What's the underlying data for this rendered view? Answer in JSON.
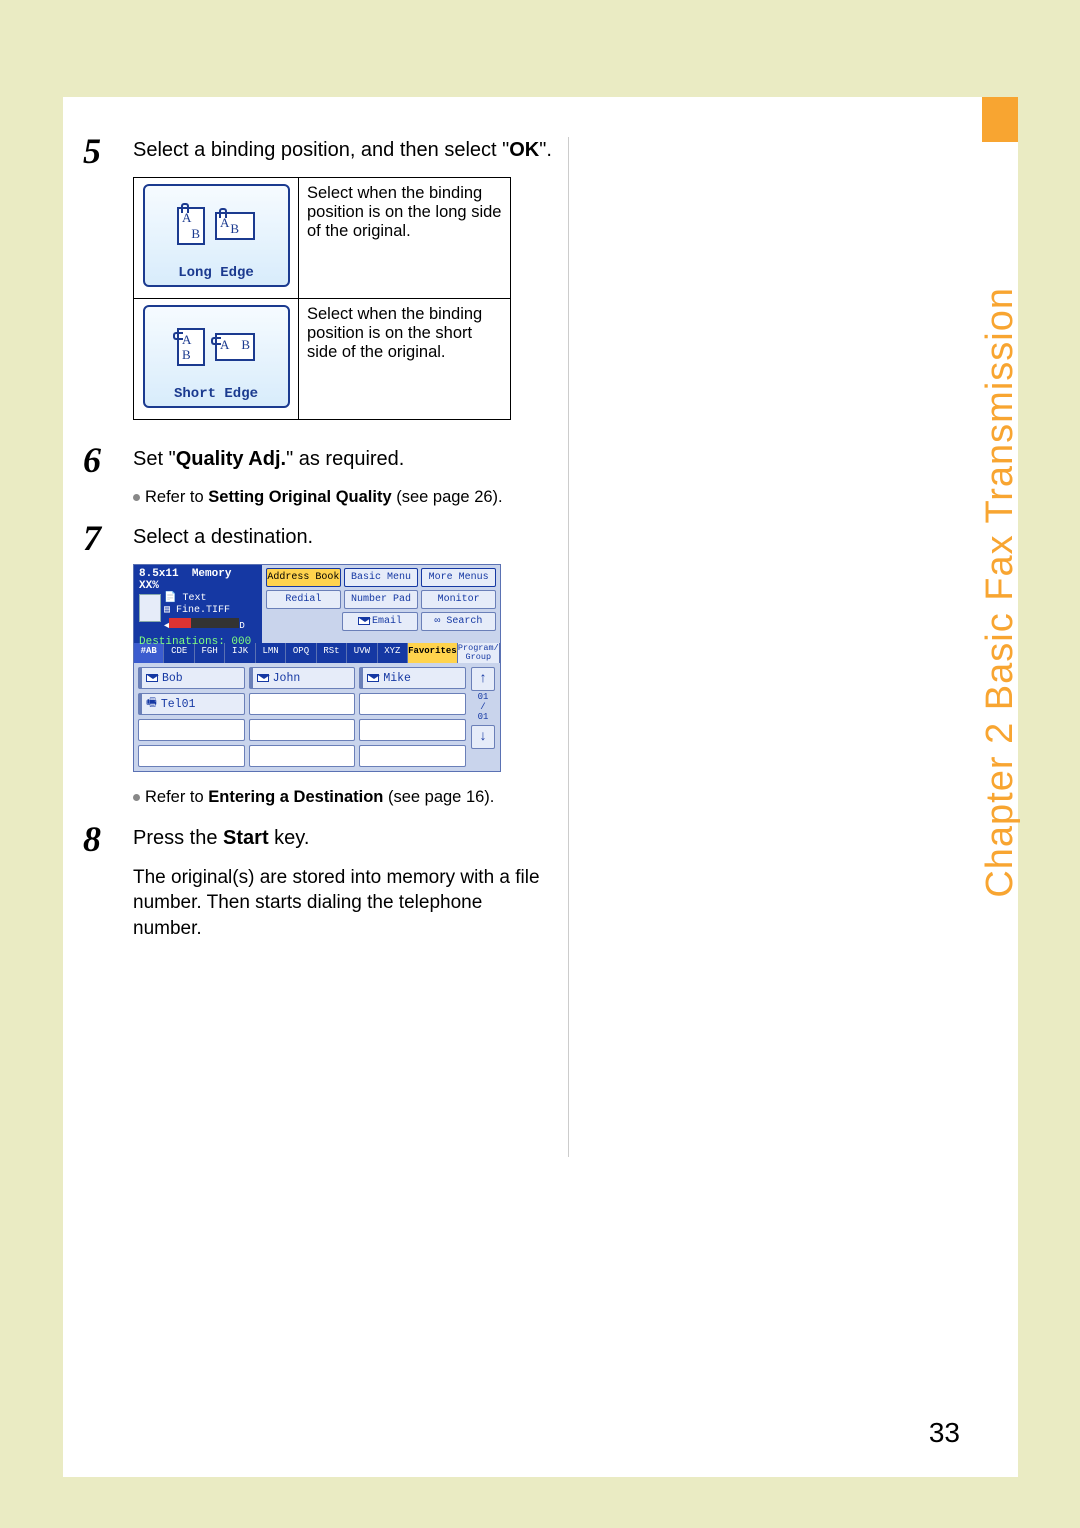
{
  "side_label": "Chapter 2    Basic Fax Transmission",
  "page_number": "33",
  "steps": {
    "s5_num": "5",
    "s5_text_a": "Select a binding position, and then select \"",
    "s5_text_b": "OK",
    "s5_text_c": "\".",
    "s6_num": "6",
    "s6_a": "Set \"",
    "s6_b": "Quality Adj.",
    "s6_c": "\" as required.",
    "s6_note_a": "Refer to ",
    "s6_note_b": "Setting Original Quality",
    "s6_note_c": " (see page 26).",
    "s7_num": "7",
    "s7_text": "Select a destination.",
    "s7_note_a": "Refer to ",
    "s7_note_b": "Entering a Destination",
    "s7_note_c": " (see page 16).",
    "s8_num": "8",
    "s8_a": "Press the ",
    "s8_b": "Start",
    "s8_c": " key.",
    "s8_desc": "The original(s) are stored into memory with a file number. Then starts dialing the telephone number."
  },
  "binding": {
    "long_label": "Long Edge",
    "long_desc": "Select when the binding position is on the long side of the original.",
    "short_label": "Short Edge",
    "short_desc": "Select when the binding position is on the short side of the original."
  },
  "lcd": {
    "paper": "8.5x11",
    "mem": "Memory XX%",
    "mode1": "Text",
    "mode2": "Fine.TIFF",
    "dest": "Destinations: 000",
    "tab_addr": "Address Book",
    "tab_basic": "Basic Menu",
    "tab_more": "More Menus",
    "btn_redial": "Redial",
    "btn_numpad": "Number Pad",
    "btn_monitor": "Monitor",
    "btn_email": "Email",
    "btn_search": "Search",
    "alpha": [
      "#AB",
      "CDE",
      "FGH",
      "IJK",
      "LMN",
      "OPQ",
      "RSt",
      "UVW",
      "XYZ"
    ],
    "fav": "Favorites",
    "prog": "Program/\nGroup",
    "entries": [
      "Bob",
      "John",
      "Mike",
      "Tel01"
    ],
    "scroll": "01\n/\n01"
  }
}
